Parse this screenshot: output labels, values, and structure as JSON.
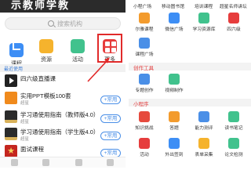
{
  "left": {
    "banner": "示教师学教",
    "search_placeholder": "搜索机构",
    "quick_actions": [
      {
        "label": "课程",
        "icon": "course-icon",
        "color": "#3d8ef5"
      },
      {
        "label": "资源",
        "icon": "folder-icon",
        "color": "#f5b32d"
      },
      {
        "label": "活动",
        "icon": "activity-icon",
        "color": "#41c28d"
      },
      {
        "label": "更多",
        "icon": "grid-icon",
        "color": "#e63d3d"
      }
    ],
    "section_title": "最近使用",
    "items": [
      {
        "title": "四六级直播课",
        "subtitle": "",
        "button": ""
      },
      {
        "title": "实用PPT模板100套",
        "subtitle": "超星",
        "button": "+常用"
      },
      {
        "title": "学习通使用指南（教师版4.0）",
        "subtitle": "超星",
        "button": "+常用"
      },
      {
        "title": "学习通使用指南（学生版4.0）",
        "subtitle": "超星",
        "button": "+常用"
      },
      {
        "title": "面试课程",
        "subtitle": "",
        "button": "+常用"
      }
    ]
  },
  "right": {
    "top_labels": [
      "小程广场",
      "移动图书馆",
      "培训课程",
      "超星名师讲坛"
    ],
    "grid_row1": [
      {
        "label": "尔雅课程",
        "icon": "book-icon",
        "color": "#f39b2d"
      },
      {
        "label": "微信广场",
        "icon": "chat-icon",
        "color": "#3d8ef5"
      },
      {
        "label": "学习资源库",
        "icon": "library-icon",
        "color": "#41c28d"
      },
      {
        "label": "四六级",
        "icon": "exam-icon",
        "color": "#e63d3d"
      }
    ],
    "grid_row2": [
      {
        "label": "课程广场",
        "icon": "square-icon",
        "color": "#4a8fe7"
      }
    ],
    "section_tools": "创作工具",
    "tools": [
      {
        "label": "专题创作",
        "icon": "topic-icon",
        "color": "#4a8fe7"
      },
      {
        "label": "视频制作",
        "icon": "video-icon",
        "color": "#41c28d"
      }
    ],
    "section_apps": "小程序",
    "apps_row1": [
      {
        "label": "知识挑战",
        "icon": "challenge-icon",
        "color": "#e64a3d"
      },
      {
        "label": "答题",
        "icon": "quiz-icon",
        "color": "#f39b2d"
      },
      {
        "label": "能力测评",
        "icon": "test-icon",
        "color": "#4a8fe7"
      },
      {
        "label": "读书笔记",
        "icon": "note-icon",
        "color": "#41c28d"
      }
    ],
    "apps_row2": [
      {
        "label": "活动",
        "icon": "event-icon",
        "color": "#e63d3d"
      },
      {
        "label": "外出签到",
        "icon": "checkin-icon",
        "color": "#3d8ef5"
      },
      {
        "label": "表单采集",
        "icon": "form-icon",
        "color": "#f5b32d"
      },
      {
        "label": "论文检测",
        "icon": "paper-icon",
        "color": "#41c28d"
      }
    ]
  },
  "colors": {
    "accent_red": "#e12a2a",
    "accent_blue": "#4a8fe7"
  }
}
